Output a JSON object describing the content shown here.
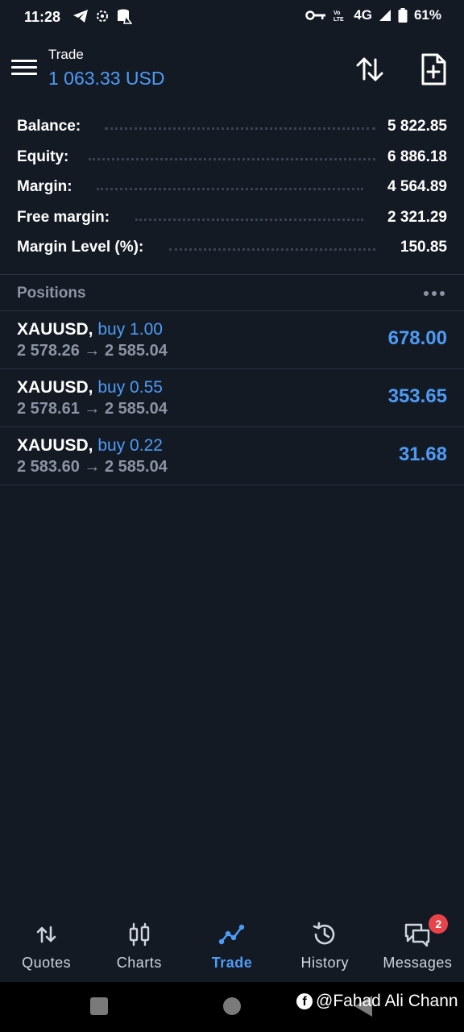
{
  "status_bar": {
    "time": "11:28",
    "network": "4G",
    "battery": "61%",
    "left_icons": [
      "telegram-icon",
      "settings-gear-icon",
      "cellular-data-icon"
    ],
    "right_icons": [
      "vpn-key-icon",
      "volte-icon",
      "signal-icon",
      "battery-icon"
    ]
  },
  "header": {
    "title": "Trade",
    "balance_display": "1 063.33 USD",
    "icons": [
      "sort-icon",
      "new-order-icon"
    ]
  },
  "summary": [
    {
      "label": "Balance:",
      "value": "5 822.85"
    },
    {
      "label": "Equity:",
      "value": "6 886.18"
    },
    {
      "label": "Margin:",
      "value": "4 564.89"
    },
    {
      "label": "Free margin:",
      "value": "2 321.29"
    },
    {
      "label": "Margin Level (%):",
      "value": "150.85"
    }
  ],
  "positions": {
    "header": "Positions",
    "items": [
      {
        "symbol": "XAUUSD,",
        "side": "buy 1.00",
        "open_price": "2 578.26",
        "arrow": "→",
        "current_price": "2 585.04",
        "profit": "678.00"
      },
      {
        "symbol": "XAUUSD,",
        "side": "buy 0.55",
        "open_price": "2 578.61",
        "arrow": "→",
        "current_price": "2 585.04",
        "profit": "353.65"
      },
      {
        "symbol": "XAUUSD,",
        "side": "buy 0.22",
        "open_price": "2 583.60",
        "arrow": "→",
        "current_price": "2 585.04",
        "profit": "31.68"
      }
    ]
  },
  "bottom_nav": {
    "items": [
      {
        "label": "Quotes",
        "icon": "quotes-icon"
      },
      {
        "label": "Charts",
        "icon": "charts-icon"
      },
      {
        "label": "Trade",
        "icon": "trade-icon",
        "active": true
      },
      {
        "label": "History",
        "icon": "history-icon"
      },
      {
        "label": "Messages",
        "icon": "messages-icon",
        "badge": "2"
      }
    ]
  },
  "watermark": {
    "icon": "facebook-icon",
    "text": "@Fahad Ali Chann"
  },
  "colors": {
    "background": "#141a24",
    "accent": "#4d9bf5",
    "muted": "#8a94a3",
    "badge": "#e8434a"
  }
}
